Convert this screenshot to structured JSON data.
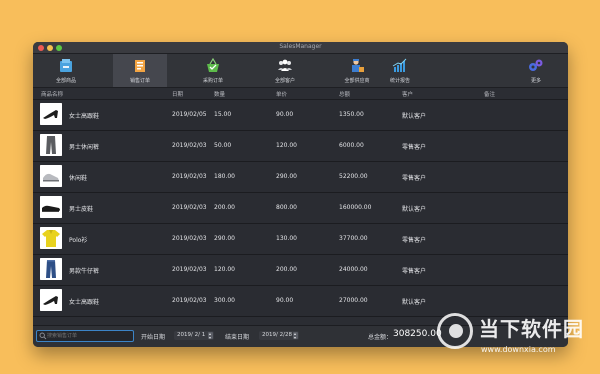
{
  "window": {
    "title": "SalesManager"
  },
  "toolbar": {
    "items": [
      {
        "label": "全部商品",
        "icon": "product-box-icon"
      },
      {
        "label": "销售订单",
        "icon": "sales-order-icon",
        "selected": true
      },
      {
        "label": "采购订单",
        "icon": "shopping-basket-icon"
      },
      {
        "label": "全部客户",
        "icon": "customers-icon"
      },
      {
        "label": "全部供应商",
        "icon": "supplier-icon"
      },
      {
        "label": "统计报告",
        "icon": "statistics-chart-icon"
      },
      {
        "label": "更多",
        "icon": "gear-icon"
      }
    ]
  },
  "table": {
    "headers": [
      "商品名称",
      "日期",
      "数量",
      "单价",
      "总额",
      "客户",
      "备注"
    ],
    "rows": [
      {
        "name": "女士高跟鞋",
        "date": "2019/02/05",
        "qty": "15.00",
        "price": "90.00",
        "total": "1350.00",
        "customer": "默认客户",
        "note": "",
        "thumb": "high-heel-shoe"
      },
      {
        "name": "男士休闲裤",
        "date": "2019/02/03",
        "qty": "50.00",
        "price": "120.00",
        "total": "6000.00",
        "customer": "零售客户",
        "note": "",
        "thumb": "trousers"
      },
      {
        "name": "休闲鞋",
        "date": "2019/02/03",
        "qty": "180.00",
        "price": "290.00",
        "total": "52200.00",
        "customer": "零售客户",
        "note": "",
        "thumb": "sneaker"
      },
      {
        "name": "男士皮鞋",
        "date": "2019/02/03",
        "qty": "200.00",
        "price": "800.00",
        "total": "160000.00",
        "customer": "默认客户",
        "note": "",
        "thumb": "leather-shoe"
      },
      {
        "name": "Polo衫",
        "date": "2019/02/03",
        "qty": "290.00",
        "price": "130.00",
        "total": "37700.00",
        "customer": "零售客户",
        "note": "",
        "thumb": "polo-shirt"
      },
      {
        "name": "男款牛仔裤",
        "date": "2019/02/03",
        "qty": "120.00",
        "price": "200.00",
        "total": "24000.00",
        "customer": "零售客户",
        "note": "",
        "thumb": "jeans"
      },
      {
        "name": "女士高跟鞋",
        "date": "2019/02/03",
        "qty": "300.00",
        "price": "90.00",
        "total": "27000.00",
        "customer": "默认客户",
        "note": "",
        "thumb": "high-heel-shoe"
      }
    ]
  },
  "footer": {
    "search_placeholder": "搜索销售订单",
    "start_label": "开始日期",
    "start_value": "2019/ 2/ 1",
    "end_label": "结束日期",
    "end_value": "2019/ 2/28",
    "total_label": "总金额：",
    "total_value": "308250.00"
  },
  "watermark": {
    "text": "当下软件园",
    "url": "www.downxia.com"
  },
  "colors": {
    "background": "#F8BE5B",
    "window": "#2B2D33",
    "accent": "#3C84C7"
  }
}
